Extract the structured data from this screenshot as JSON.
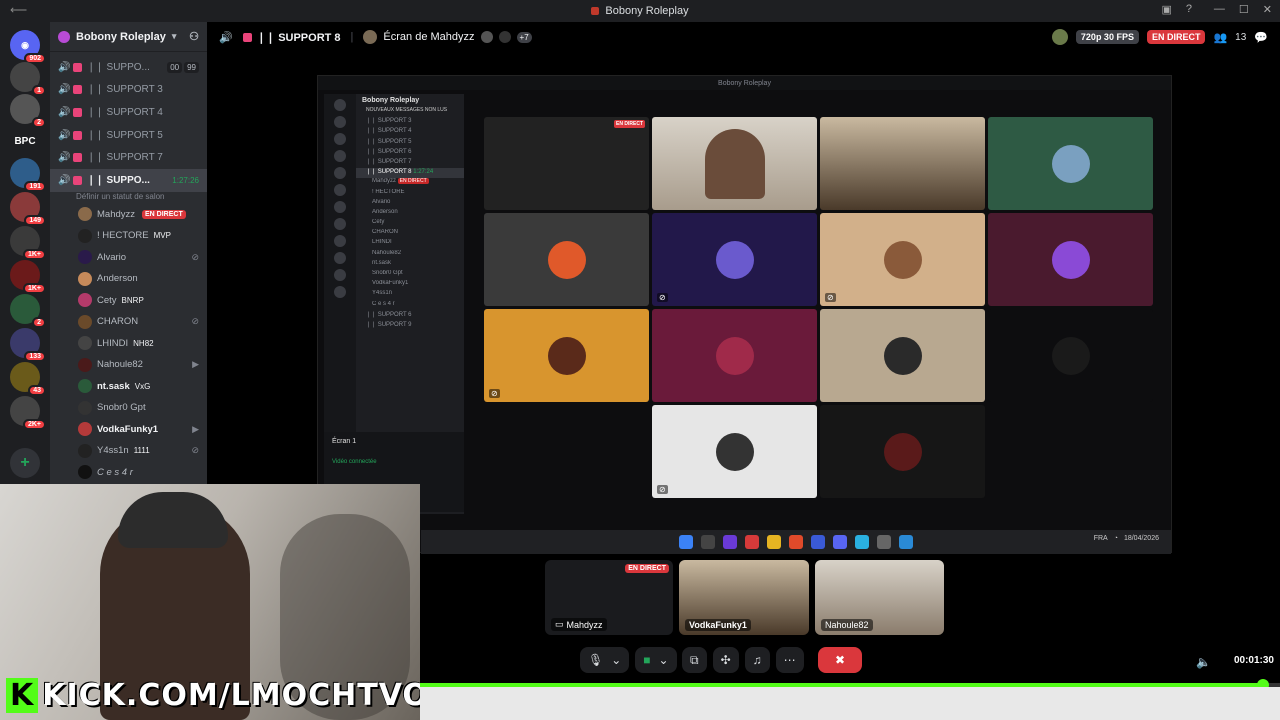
{
  "window": {
    "title": "Bobony Roleplay"
  },
  "rail": {
    "badges": [
      "902",
      "1",
      "2",
      "191",
      "149",
      "1K+",
      "1K+",
      "2",
      "133",
      "43",
      "2K+"
    ],
    "bpc_label": "BPC"
  },
  "sidebar": {
    "server_name": "Bobony Roleplay",
    "channels": [
      {
        "name": "❘❘ SUPPO...",
        "extra": [
          "00",
          "99"
        ]
      },
      {
        "name": "❘❘ SUPPORT 3"
      },
      {
        "name": "❘❘ SUPPORT 4"
      },
      {
        "name": "❘❘ SUPPORT 5"
      },
      {
        "name": "❘❘ SUPPORT 7"
      }
    ],
    "active_channel": {
      "name": "❘❘ SUPPO...",
      "time": "1:27:26",
      "status": "Définir un statut de salon"
    },
    "members": [
      {
        "name": "Mahdyzz",
        "live": "EN DIRECT",
        "suffix": ""
      },
      {
        "name": "! HECTORE",
        "suffix": "MVP"
      },
      {
        "name": "Alvario",
        "suffix": ""
      },
      {
        "name": "Anderson",
        "suffix": ""
      },
      {
        "name": "Cety",
        "suffix": "BNRP"
      },
      {
        "name": "CHARON",
        "suffix": ""
      },
      {
        "name": "LHINDI",
        "suffix": "NH82"
      },
      {
        "name": "Nahoule82",
        "suffix": ""
      },
      {
        "name": "nt.sask",
        "suffix": "VxG"
      },
      {
        "name": "Snobr0 Gpt",
        "suffix": ""
      },
      {
        "name": "VodkaFunky1",
        "suffix": ""
      },
      {
        "name": "Y4ss1n",
        "suffix": "1111"
      },
      {
        "name": "C e s 4 r",
        "suffix": ""
      }
    ]
  },
  "topbar": {
    "channel": "❘❘ SUPPORT 8",
    "screen_label": "Écran de Mahdyzz",
    "extra_viewers": "+7",
    "quality": "720p 30 FPS",
    "live": "EN DIRECT",
    "viewer_count": "13"
  },
  "shared_screen": {
    "title": "Bobony Roleplay",
    "server": "Bobony Roleplay",
    "new_messages": "NOUVEAUX MESSAGES NON LUS",
    "lines": [
      "❘❘ SUPPORT 3",
      "❘❘ SUPPORT 4",
      "❘❘ SUPPORT 5",
      "❘❘ SUPPORT 6",
      "❘❘ SUPPORT 7",
      "❘❘ SUPPORT 8",
      "Mahdyzz",
      "! HECTORE",
      "Alvario",
      "Anderson",
      "Cety",
      "CHARON",
      "LHINDI",
      "Nahoule82",
      "nt.sask",
      "Snobr0 Gpt",
      "VodkaFunky1",
      "Y4ss1n",
      "C e s 4 r",
      "❘❘ SUPPORT 6",
      "❘❘ SUPPORT 9"
    ],
    "inner_time": "1:27:24",
    "inner_live": "EN DIRECT",
    "screen_1": "Écran 1",
    "video_connected": "Vidéo connectée",
    "tray": {
      "lang": "FRA",
      "date": "18/04/2026"
    }
  },
  "streams": [
    {
      "name": "Mahdyzz",
      "live": "EN DIRECT"
    },
    {
      "name": "VodkaFunky1"
    },
    {
      "name": "Nahoule82"
    }
  ],
  "overlay": {
    "kick_text": "KICK.COM/LMOCHTVO",
    "kick_logo": "K"
  },
  "player": {
    "time": "00:01:30"
  },
  "colors": {
    "live": "#da373c",
    "kick_green": "#53fc18",
    "discord_bg": "#2b2d31"
  }
}
